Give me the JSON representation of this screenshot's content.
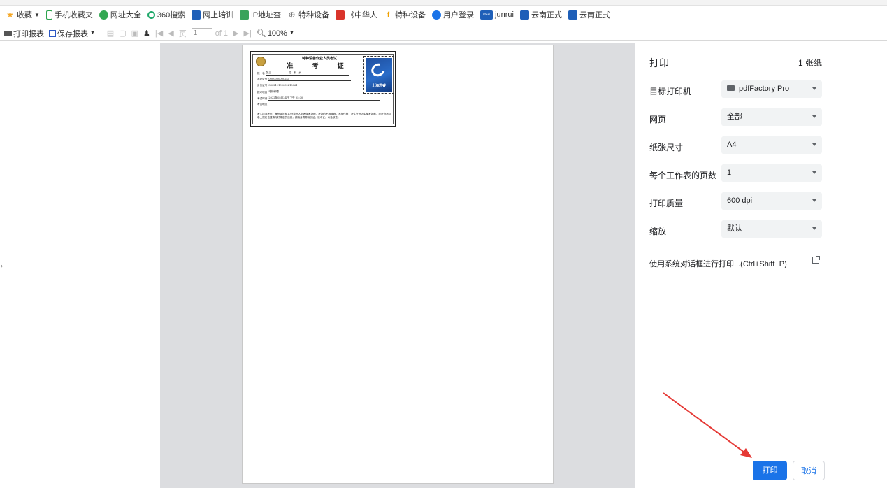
{
  "bookmarks": [
    {
      "label": "收藏",
      "icon": "star-icon",
      "color": "#f5a623"
    },
    {
      "label": "手机收藏夹",
      "icon": "phone-icon",
      "color": "#2da44e"
    },
    {
      "label": "网址大全",
      "icon": "globe-icon",
      "color": "#34a853"
    },
    {
      "label": "360搜索",
      "icon": "search-icon",
      "color": "#1fa86a"
    },
    {
      "label": "网上培训",
      "icon": "site-icon",
      "color": "#1e5fb8"
    },
    {
      "label": "iP地址查",
      "icon": "site-icon",
      "color": "#3aa35b"
    },
    {
      "label": "特种设备",
      "icon": "globe-icon",
      "color": "#777777"
    },
    {
      "label": "《中华人",
      "icon": "site-icon",
      "color": "#d9342b"
    },
    {
      "label": "特种设备",
      "icon": "site-icon",
      "color": "#f0a000"
    },
    {
      "label": "用户登录",
      "icon": "site-icon",
      "color": "#1a73e8"
    },
    {
      "label": "junrui",
      "icon": "site-icon",
      "color": "#1e5fb8"
    },
    {
      "label": "云南正式",
      "icon": "site-icon",
      "color": "#1e5fb8"
    },
    {
      "label": "云南正式",
      "icon": "site-icon",
      "color": "#1e5fb8"
    }
  ],
  "toolbar": {
    "print_report": "打印报表",
    "save_report": "保存报表",
    "page_value": "1",
    "of_pages": "of 1",
    "zoom": "100%"
  },
  "card": {
    "title_small": "特种设备作业人员考试",
    "title_big": "准 考 证",
    "fields": [
      {
        "label": "姓　名",
        "value": "张三　　　　　　　性　别　女"
      },
      {
        "label": "准考证号",
        "value": "0000000000245"
      },
      {
        "label": "身份证号",
        "value": "330211199002210061"
      },
      {
        "label": "报考项目",
        "value": "电梯修理"
      },
      {
        "label": "考试时间",
        "value": "2022年05月24日 下午 05:30"
      },
      {
        "label": "考试地点",
        "value": ""
      }
    ],
    "notice": "考生持准考证、身份证提前10分钟进入机考候考场地，考场内不得喧哗，不得作弊！考生在进入实操考场前，应在查看试卷上规定位置填写好规定的信息，并随身携带身份证、准考证，以备核查。",
    "photo_text": "上海君睿"
  },
  "panel": {
    "title": "打印",
    "sheets": "1 张纸",
    "rows": [
      {
        "label": "目标打印机",
        "value": "pdfFactory Pro"
      },
      {
        "label": "网页",
        "value": "全部"
      },
      {
        "label": "纸张尺寸",
        "value": "A4"
      },
      {
        "label": "每个工作表的页数",
        "value": "1"
      },
      {
        "label": "打印质量",
        "value": "600 dpi"
      },
      {
        "label": "缩放",
        "value": "默认"
      }
    ],
    "system_dialog": "使用系统对话框进行打印...(Ctrl+Shift+P)",
    "print_button": "打印",
    "cancel_button": "取消"
  },
  "colors": {
    "accent": "#1a73e8",
    "annotation_arrow": "#e53935"
  }
}
